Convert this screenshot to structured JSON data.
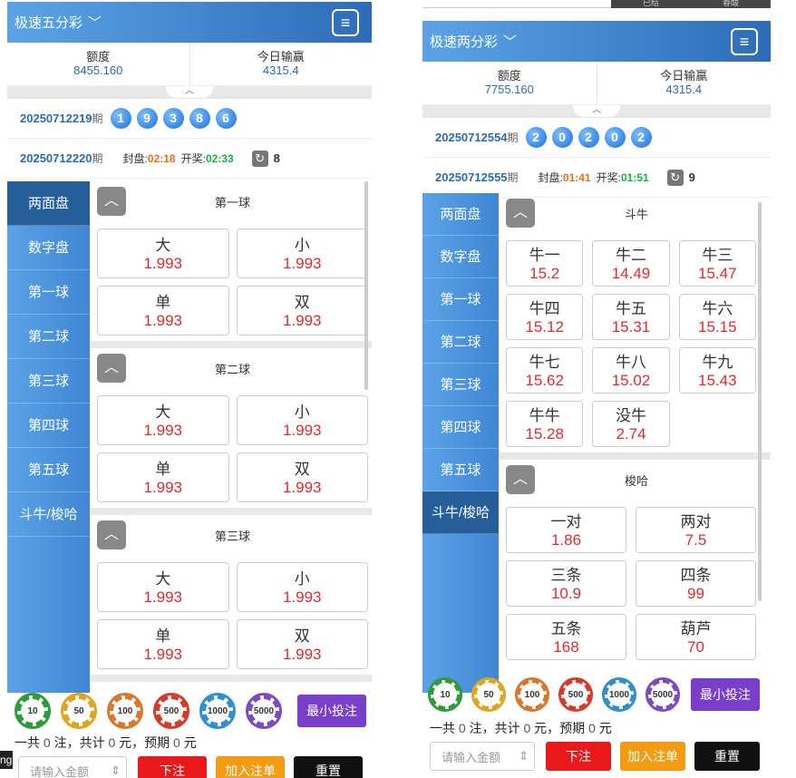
{
  "left": {
    "title": "极速五分彩",
    "menu_icon": "≡",
    "balance_label": "额度",
    "balance": "8455.160",
    "win_label": "今日输赢",
    "win": "4315.4",
    "last_issue": "20250712219",
    "issue_suffix": "期",
    "balls": [
      "1",
      "9",
      "3",
      "8",
      "6"
    ],
    "cur_issue": "20250712220",
    "close_label": "封盘:",
    "close": "02:18",
    "open_label": "开奖:",
    "open": "02:33",
    "refresh_count": "8",
    "nav": [
      "两面盘",
      "数字盘",
      "第一球",
      "第二球",
      "第三球",
      "第四球",
      "第五球",
      "斗牛/梭哈"
    ],
    "sections": [
      {
        "name": "第一球",
        "cells": [
          {
            "l": "大",
            "o": "1.993"
          },
          {
            "l": "小",
            "o": "1.993"
          },
          {
            "l": "单",
            "o": "1.993"
          },
          {
            "l": "双",
            "o": "1.993"
          }
        ]
      },
      {
        "name": "第二球",
        "cells": [
          {
            "l": "大",
            "o": "1.993"
          },
          {
            "l": "小",
            "o": "1.993"
          },
          {
            "l": "单",
            "o": "1.993"
          },
          {
            "l": "双",
            "o": "1.993"
          }
        ]
      },
      {
        "name": "第三球",
        "cells": [
          {
            "l": "大",
            "o": "1.993"
          },
          {
            "l": "小",
            "o": "1.993"
          },
          {
            "l": "单",
            "o": "1.993"
          },
          {
            "l": "双",
            "o": "1.993"
          }
        ]
      }
    ],
    "summary": {
      "a": "一共",
      "n1": "0",
      "b": "注，共计",
      "n2": "0",
      "c": "元，预期",
      "n3": "0",
      "d": "元"
    },
    "amount_placeholder": "请输入金额",
    "bet": "下注",
    "add": "加入注单",
    "reset": "重置"
  },
  "right": {
    "title": "极速两分彩",
    "menu_icon": "≡",
    "balance_label": "额度",
    "balance": "7755.160",
    "win_label": "今日输赢",
    "win": "4315.4",
    "last_issue": "20250712554",
    "issue_suffix": "期",
    "balls": [
      "2",
      "0",
      "2",
      "0",
      "2"
    ],
    "cur_issue": "20250712555",
    "close_label": "封盘:",
    "close": "01:41",
    "open_label": "开奖:",
    "open": "01:51",
    "refresh_count": "9",
    "nav": [
      "两面盘",
      "数字盘",
      "第一球",
      "第二球",
      "第三球",
      "第四球",
      "第五球",
      "斗牛/梭哈"
    ],
    "sections": [
      {
        "name": "斗牛",
        "cells": [
          {
            "l": "牛一",
            "o": "15.2"
          },
          {
            "l": "牛二",
            "o": "14.49"
          },
          {
            "l": "牛三",
            "o": "15.47"
          },
          {
            "l": "牛四",
            "o": "15.12"
          },
          {
            "l": "牛五",
            "o": "15.31"
          },
          {
            "l": "牛六",
            "o": "15.15"
          },
          {
            "l": "牛七",
            "o": "15.62"
          },
          {
            "l": "牛八",
            "o": "15.02"
          },
          {
            "l": "牛九",
            "o": "15.43"
          },
          {
            "l": "牛牛",
            "o": "15.28"
          },
          {
            "l": "没牛",
            "o": "2.74"
          }
        ]
      },
      {
        "name": "梭哈",
        "cells": [
          {
            "l": "一对",
            "o": "1.86"
          },
          {
            "l": "两对",
            "o": "7.5"
          },
          {
            "l": "三条",
            "o": "10.9"
          },
          {
            "l": "四条",
            "o": "99"
          },
          {
            "l": "五条",
            "o": "168"
          },
          {
            "l": "葫芦",
            "o": "70"
          }
        ]
      }
    ],
    "summary": {
      "a": "一共",
      "n1": "0",
      "b": "注，共计",
      "n2": "0",
      "c": "元，预期",
      "n3": "0",
      "d": "元"
    },
    "amount_placeholder": "请输入金额",
    "bet": "下注",
    "add": "加入注单",
    "reset": "重置"
  },
  "chips": [
    {
      "v": "10",
      "color": "#2e9b3a"
    },
    {
      "v": "50",
      "color": "#e0a51f"
    },
    {
      "v": "100",
      "color": "#d9782a"
    },
    {
      "v": "500",
      "color": "#d83a2a"
    },
    {
      "v": "1000",
      "color": "#2f8fd0"
    },
    {
      "v": "5000",
      "color": "#7b4cc1"
    }
  ],
  "min_bet": "最小投注",
  "top_right_tabs": [
    "已结",
    "春酸"
  ],
  "corner_text": "ng"
}
